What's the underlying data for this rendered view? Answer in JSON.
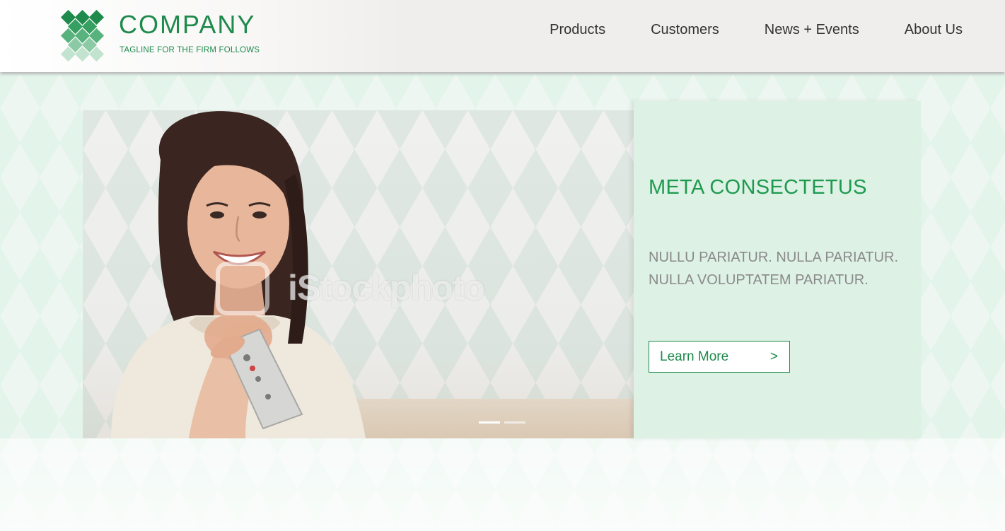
{
  "brand": {
    "name": "COMPANY",
    "tagline": "TAGLINE FOR THE FIRM FOLLOWS",
    "color": "#1e8a4c"
  },
  "nav": {
    "items": [
      {
        "label": "Products"
      },
      {
        "label": "Customers"
      },
      {
        "label": "News + Events"
      },
      {
        "label": "About Us"
      }
    ]
  },
  "hero": {
    "watermark": "iStockphoto",
    "slide_count": 2,
    "active_slide": 1,
    "panel": {
      "title": "META CONSECTETUS",
      "body": "NULLU PARIATUR. NULLA PARIATUR. NULLA VOLUPTATEM PARIATUR.",
      "button_label": "Learn More",
      "button_arrow": ">",
      "accent": "#1e9a4e",
      "background": "#ddf1e5"
    }
  }
}
